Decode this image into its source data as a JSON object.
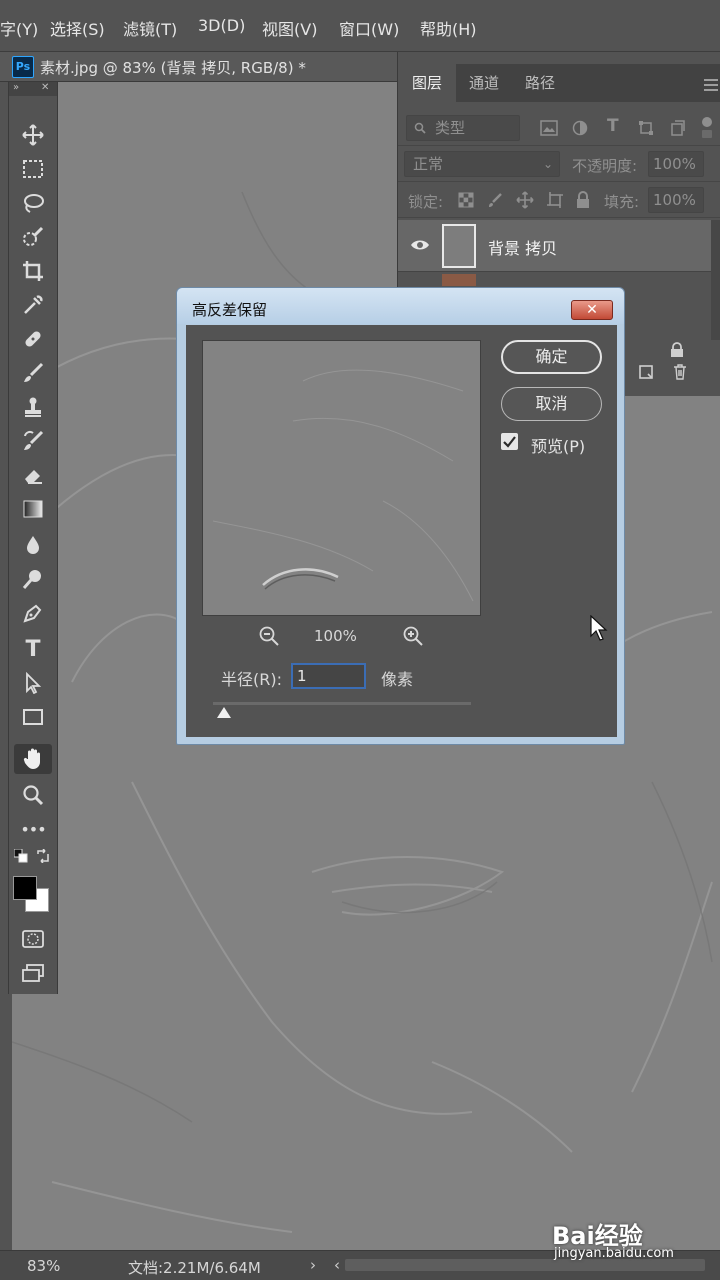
{
  "menu": [
    "字(Y)",
    "选择(S)",
    "滤镜(T)",
    "3D(D)",
    "视图(V)",
    "窗口(W)",
    "帮助(H)"
  ],
  "document": {
    "app_badge": "Ps",
    "tab_title": "素材.jpg @ 83% (背景 拷贝, RGB/8) *"
  },
  "tools": [
    "move-icon",
    "marquee-icon",
    "lasso-icon",
    "quick-selection-icon",
    "crop-icon",
    "eyedropper-icon",
    "healing-brush-icon",
    "brush-icon",
    "clone-stamp-icon",
    "history-brush-icon",
    "eraser-icon",
    "gradient-icon",
    "blur-icon",
    "dodge-icon",
    "pen-icon",
    "type-icon",
    "path-selection-icon",
    "rectangle-icon",
    "hand-icon",
    "zoom-icon",
    "more-tools-icon"
  ],
  "tool_glyphs": {
    "type": "T",
    "more": "•••"
  },
  "active_tool": "hand-icon",
  "colors": {
    "foreground": "#000000",
    "background": "#ffffff"
  },
  "layers_panel": {
    "tabs": [
      "图层",
      "通道",
      "路径"
    ],
    "active_tab": "图层",
    "filter_placeholder": "类型",
    "blend_mode": "正常",
    "opacity_label": "不透明度:",
    "opacity_value": "100%",
    "lock_label": "锁定:",
    "fill_label": "填充:",
    "fill_value": "100%",
    "layers": [
      {
        "name": "背景 拷贝",
        "visible": true
      }
    ]
  },
  "dialog": {
    "title": "高反差保留",
    "close_glyph": "✕",
    "zoom_value": "100%",
    "radius_label": "半径(R):",
    "radius_value": "1",
    "unit": "像素",
    "slider_value": 1,
    "ok_label": "确定",
    "cancel_label": "取消",
    "preview_label": "预览(P)",
    "preview_checked": true
  },
  "status_bar": {
    "zoom": "83%",
    "doc_info": "文档:2.21M/6.64M",
    "nav_next": "›",
    "nav_prev": "‹"
  },
  "watermark": {
    "brand": "Bai经验",
    "url": "jingyan.baidu.com"
  }
}
